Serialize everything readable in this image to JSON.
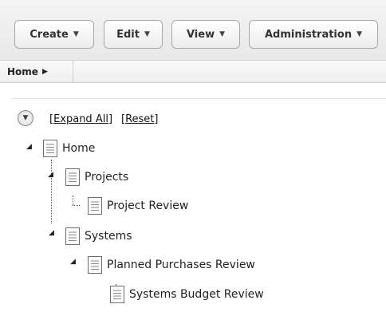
{
  "toolbar": {
    "buttons": [
      {
        "label": "Create"
      },
      {
        "label": "Edit"
      },
      {
        "label": "View"
      },
      {
        "label": "Administration"
      }
    ]
  },
  "breadcrumb": {
    "items": [
      {
        "label": "Home"
      }
    ]
  },
  "tree_controls": {
    "expand_all": "[Expand All]",
    "reset": "[Reset]"
  },
  "tree": {
    "nodes": [
      {
        "label": "Home",
        "expanded": true
      },
      {
        "label": "Projects",
        "expanded": true
      },
      {
        "label": "Project Review"
      },
      {
        "label": "Systems",
        "expanded": true
      },
      {
        "label": "Planned Purchases Review",
        "expanded": true
      },
      {
        "label": "Systems Budget Review"
      }
    ]
  }
}
